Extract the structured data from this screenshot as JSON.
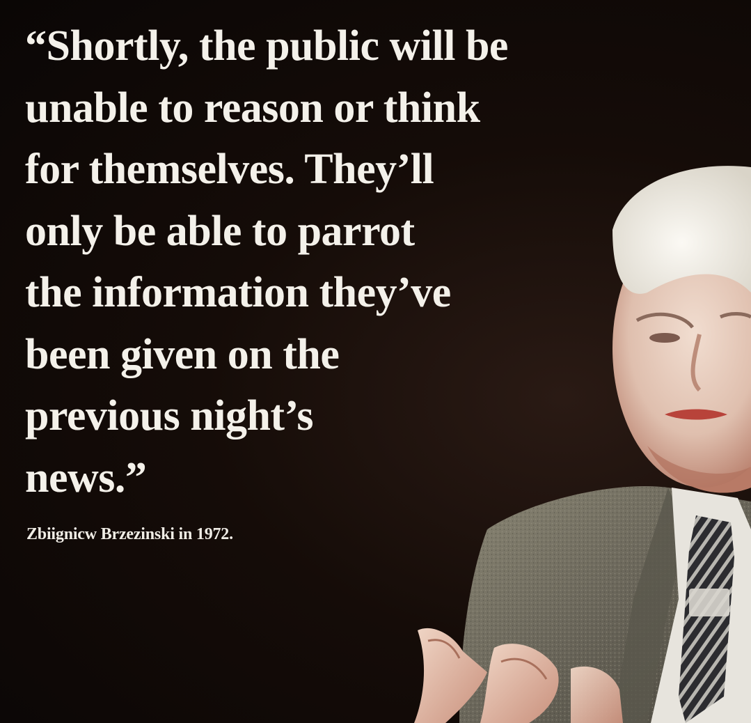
{
  "quote": {
    "lines": [
      "“Shortly, the public will be",
      "unable to reason or think",
      "for themselves. They’ll",
      "only be able to parrot",
      "the information they’ve",
      "been given on the",
      "previous night’s",
      "news.”"
    ]
  },
  "attribution": "Zbiignicw Brzezinski in 1972.",
  "colors": {
    "background": "#120a07",
    "text": "#f4f1ea",
    "jacket": "#6f6a5c",
    "hair": "#e9e6df",
    "skin": "#d9b8a0"
  },
  "portrait": {
    "subject": "elderly man in grey tweed jacket and striped tie, gesturing with hands"
  }
}
